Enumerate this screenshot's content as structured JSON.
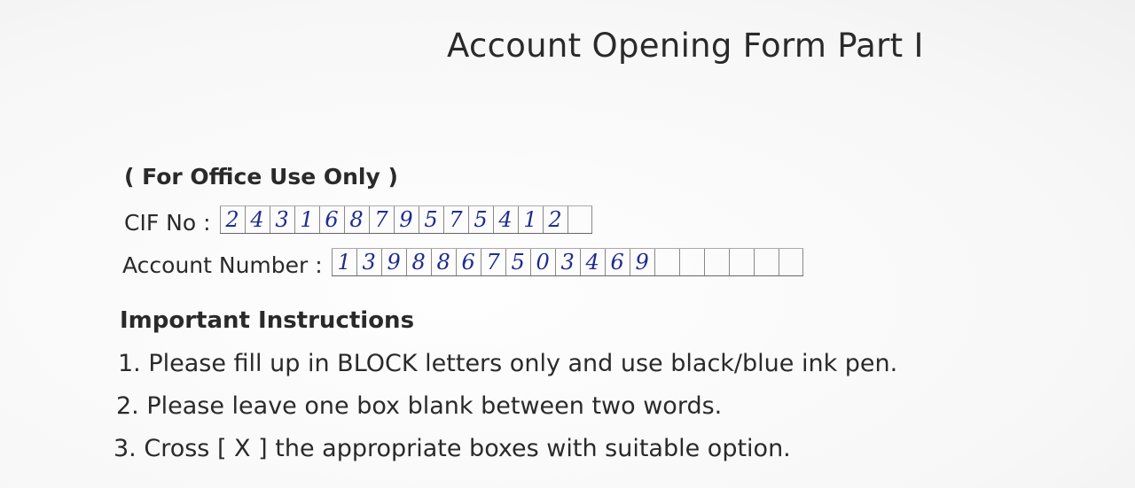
{
  "form": {
    "title": "Account Opening Form Part I",
    "office_use_label": "( For Office Use Only )",
    "cif": {
      "label": "CIF No :",
      "digits": [
        "2",
        "4",
        "3",
        "1",
        "6",
        "8",
        "7",
        "9",
        "5",
        "7",
        "5",
        "4",
        "1",
        "2",
        ""
      ],
      "value": "24316879575412"
    },
    "account": {
      "label": "Account Number :",
      "digits": [
        "1",
        "3",
        "9",
        "8",
        "8",
        "6",
        "7",
        "5",
        "0",
        "3",
        "4",
        "6",
        "9",
        "",
        "",
        "",
        "",
        "",
        ""
      ],
      "value": "1398867503469"
    }
  },
  "instructions": {
    "heading": "Important Instructions",
    "items": [
      "1. Please fill up in BLOCK letters only and use black/blue ink pen.",
      "2. Please leave one box blank between two words.",
      "3. Cross [ X ] the appropriate boxes with suitable option."
    ]
  },
  "colors": {
    "ink": "#1f2c8f",
    "print": "#2a2a2a"
  }
}
